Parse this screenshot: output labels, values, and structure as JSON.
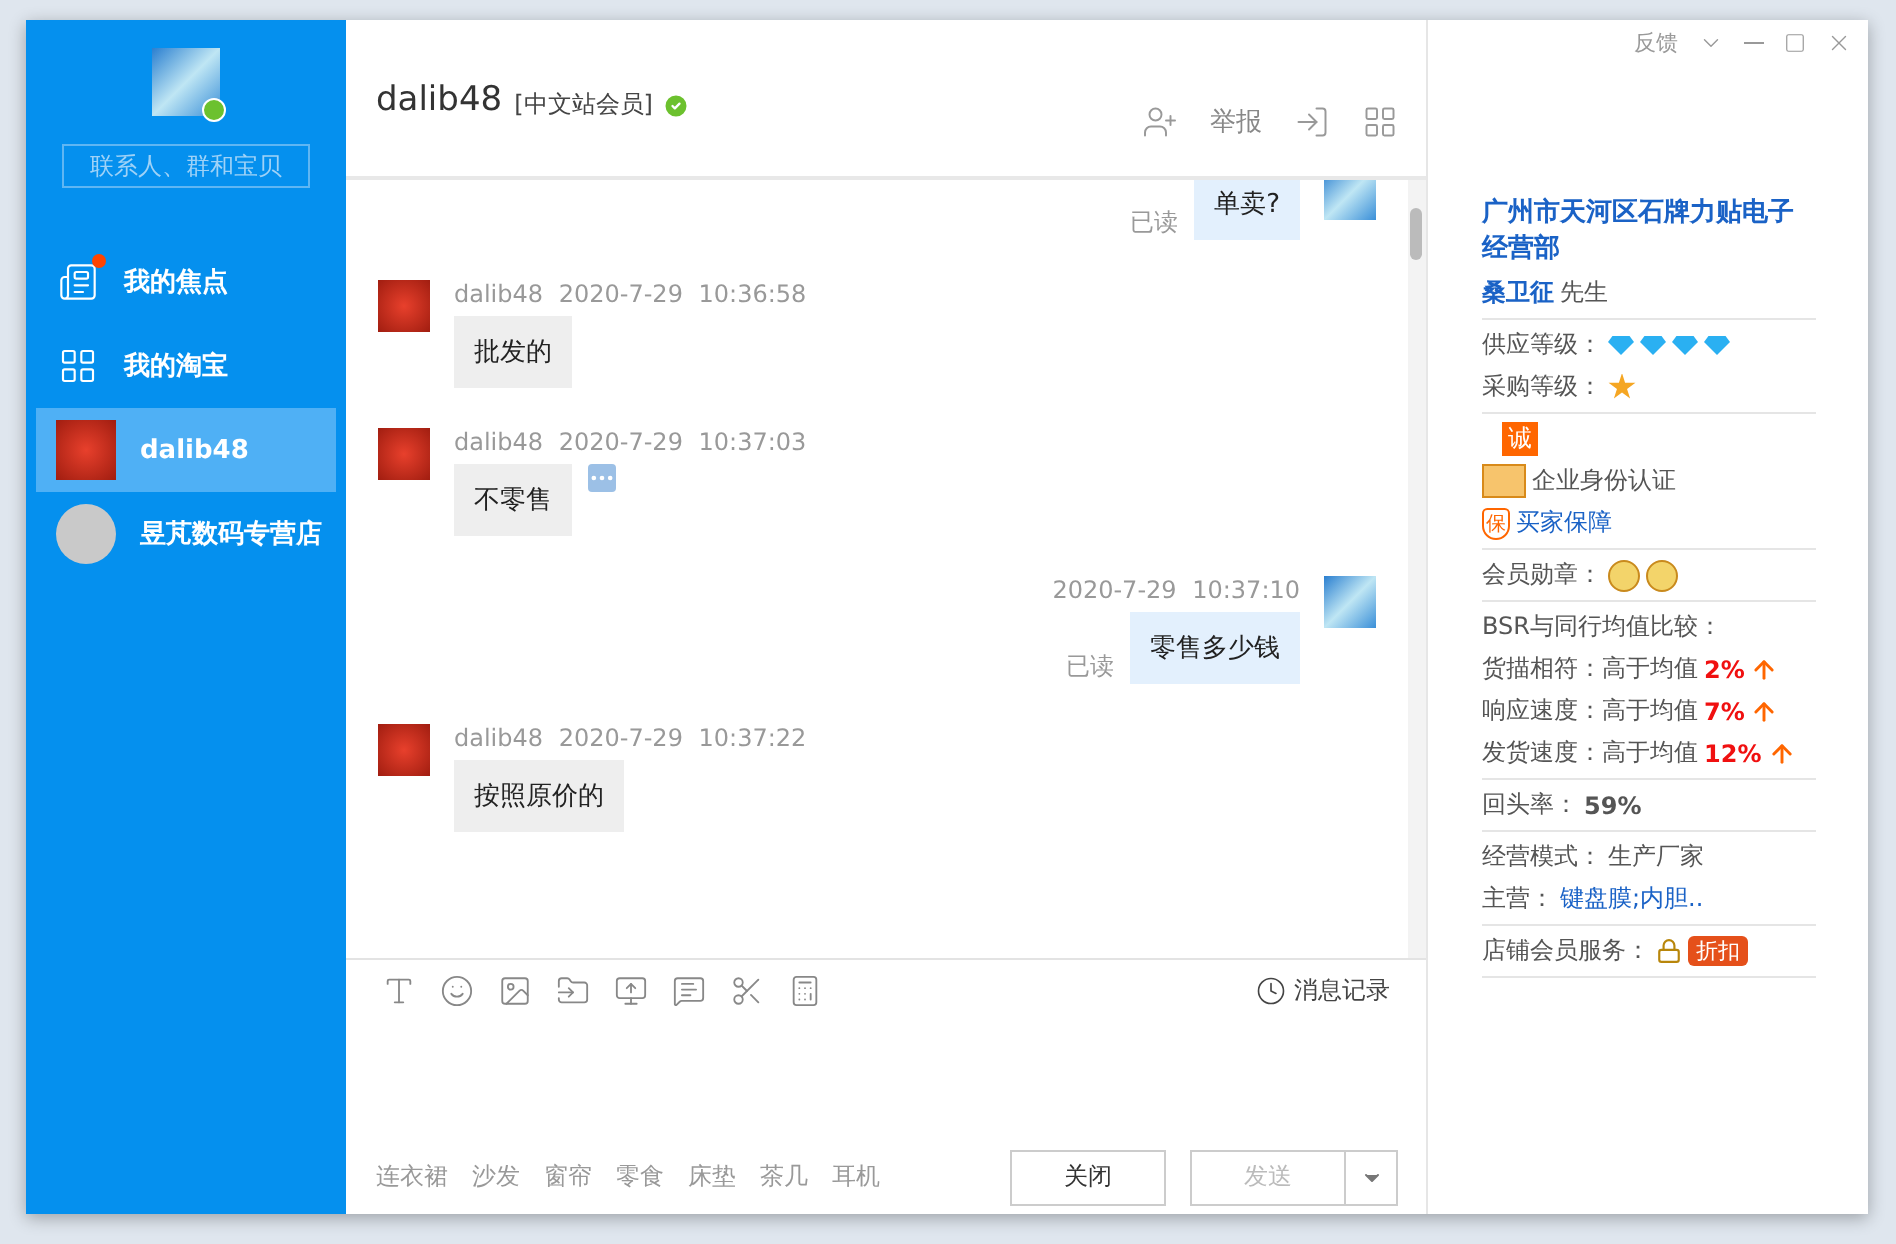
{
  "sidebar": {
    "search": {
      "placeholder": "联系人、群和宝贝"
    },
    "nav": [
      {
        "kind": "focus",
        "label": "我的焦点",
        "badge": true
      },
      {
        "kind": "taobao",
        "label": "我的淘宝",
        "badge": false
      }
    ],
    "contacts": [
      {
        "kind": "logo",
        "name": "dalib48",
        "selected": true
      },
      {
        "kind": "shop",
        "name": "昱芃数码专营店",
        "selected": false
      }
    ]
  },
  "window_controls": {
    "feedback": "反馈"
  },
  "header": {
    "name": "dalib48",
    "tag": "[中文站会员]",
    "verified": true,
    "report": "举报"
  },
  "messages": [
    {
      "kind": "self",
      "text": "单卖?",
      "status": "已读"
    },
    {
      "kind": "other",
      "sender": "dalib48",
      "time": "2020-7-29 10:36:58",
      "text": "批发的"
    },
    {
      "kind": "other",
      "sender": "dalib48",
      "time": "2020-7-29 10:37:03",
      "text": "不零售",
      "menu": true
    },
    {
      "kind": "self",
      "time": "2020-7-29 10:37:10",
      "text": "零售多少钱",
      "status": "已读"
    },
    {
      "kind": "other",
      "sender": "dalib48",
      "time": "2020-7-29 10:37:22",
      "text": "按照原价的"
    }
  ],
  "composer": {
    "history": "消息记录",
    "phrases": [
      "连衣裙",
      "沙发",
      "窗帘",
      "零食",
      "床垫",
      "茶几",
      "耳机"
    ],
    "close": "关闭",
    "send": {
      "label": "发送",
      "disabled": true
    }
  },
  "profile": {
    "company": "广州市天河区石牌力贴电子经营部",
    "contact": "桑卫征",
    "title": "先生",
    "grades": [
      {
        "label": "供应等级：",
        "icons": [
          {
            "kind": "diamond"
          },
          {
            "kind": "diamond"
          },
          {
            "kind": "diamond"
          },
          {
            "kind": "diamond"
          }
        ]
      },
      {
        "label": "采购等级：",
        "icons": [
          {
            "kind": "medal"
          }
        ]
      }
    ],
    "cheng": "诚",
    "certification": "企业身份认证",
    "guarantee": {
      "mark": "保",
      "label": "买家保障"
    },
    "medals": {
      "label": "会员勋章：",
      "icons": [
        {
          "kind": "badge"
        },
        {
          "kind": "badge"
        }
      ]
    },
    "bsr": {
      "title": "BSR与同行均值比较：",
      "rows": [
        {
          "label": "货描相符：",
          "text": "高于均值",
          "value": "2%"
        },
        {
          "label": "响应速度：",
          "text": "高于均值",
          "value": "7%"
        },
        {
          "label": "发货速度：",
          "text": "高于均值",
          "value": "12%"
        }
      ]
    },
    "repeat": {
      "label": "回头率：",
      "value": "59%"
    },
    "mode": {
      "label": "经营模式：",
      "value": "生产厂家"
    },
    "main": {
      "label": "主营：",
      "value": "键盘膜;内胆.."
    },
    "service": {
      "label": "店铺会员服务：",
      "tag": "折扣"
    }
  }
}
